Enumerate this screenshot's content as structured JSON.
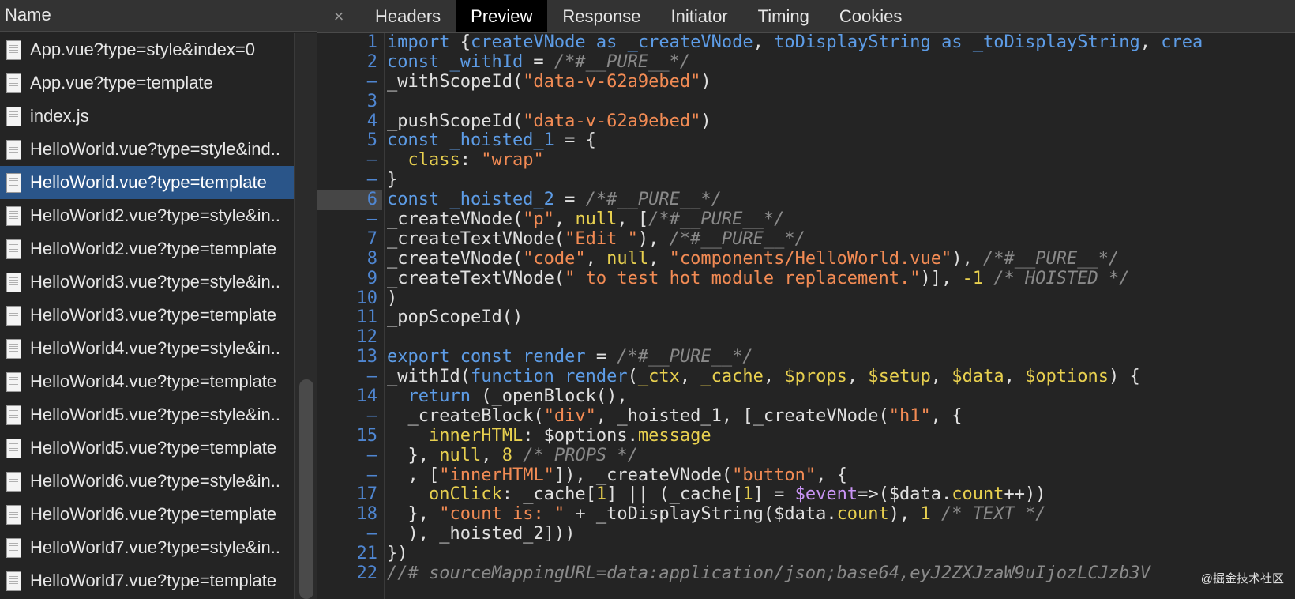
{
  "sidebar": {
    "header": "Name",
    "selected_index": 4,
    "files": [
      "App.vue?type=style&index=0",
      "App.vue?type=template",
      "index.js",
      "HelloWorld.vue?type=style&ind..",
      "HelloWorld.vue?type=template",
      "HelloWorld2.vue?type=style&in..",
      "HelloWorld2.vue?type=template",
      "HelloWorld3.vue?type=style&in..",
      "HelloWorld3.vue?type=template",
      "HelloWorld4.vue?type=style&in..",
      "HelloWorld4.vue?type=template",
      "HelloWorld5.vue?type=style&in..",
      "HelloWorld5.vue?type=template",
      "HelloWorld6.vue?type=style&in..",
      "HelloWorld6.vue?type=template",
      "HelloWorld7.vue?type=style&in..",
      "HelloWorld7.vue?type=template"
    ]
  },
  "tabs": {
    "close_glyph": "×",
    "items": [
      "Headers",
      "Preview",
      "Response",
      "Initiator",
      "Timing",
      "Cookies"
    ],
    "active_index": 1
  },
  "code": {
    "highlight_line_index": 8,
    "lines": [
      {
        "n": "1",
        "t": [
          [
            "kw",
            "import "
          ],
          [
            "",
            "{"
          ],
          [
            "kw",
            "createVNode"
          ],
          [
            "",
            " "
          ],
          [
            "kw",
            "as"
          ],
          [
            "",
            " "
          ],
          [
            "kw",
            "_createVNode"
          ],
          [
            "",
            ", "
          ],
          [
            "kw",
            "toDisplayString"
          ],
          [
            "",
            " "
          ],
          [
            "kw",
            "as"
          ],
          [
            "",
            " "
          ],
          [
            "kw",
            "_toDisplayString"
          ],
          [
            "",
            ", "
          ],
          [
            "kw",
            "crea"
          ]
        ]
      },
      {
        "n": "2",
        "t": [
          [
            "kw",
            "const _withId"
          ],
          [
            "",
            " = "
          ],
          [
            "cm",
            "/*#__PURE__*/"
          ]
        ]
      },
      {
        "n": "–",
        "t": [
          [
            "",
            "_withScopeId("
          ],
          [
            "str",
            "\"data-v-62a9ebed\""
          ],
          [
            "",
            ")"
          ]
        ]
      },
      {
        "n": "3",
        "t": []
      },
      {
        "n": "4",
        "t": [
          [
            "",
            "_pushScopeId("
          ],
          [
            "str",
            "\"data-v-62a9ebed\""
          ],
          [
            "",
            ")"
          ]
        ]
      },
      {
        "n": "5",
        "t": [
          [
            "kw",
            "const _hoisted_1"
          ],
          [
            "",
            " = {"
          ]
        ]
      },
      {
        "n": "–",
        "t": [
          [
            "key",
            "  class"
          ],
          [
            "",
            ": "
          ],
          [
            "str",
            "\"wrap\""
          ]
        ]
      },
      {
        "n": "–",
        "t": [
          [
            "",
            "}"
          ]
        ]
      },
      {
        "n": "6",
        "t": [
          [
            "kw",
            "const _hoisted_2"
          ],
          [
            "",
            " = "
          ],
          [
            "cm",
            "/*#__PURE__*/"
          ]
        ]
      },
      {
        "n": "–",
        "t": [
          [
            "",
            "_createVNode("
          ],
          [
            "str",
            "\"p\""
          ],
          [
            "",
            ", "
          ],
          [
            "key",
            "null"
          ],
          [
            "",
            ", ["
          ],
          [
            "cm",
            "/*#__PURE__*/"
          ]
        ]
      },
      {
        "n": "7",
        "t": [
          [
            "",
            "_createTextVNode("
          ],
          [
            "str",
            "\"Edit \""
          ],
          [
            "",
            "), "
          ],
          [
            "cm",
            "/*#__PURE__*/"
          ]
        ]
      },
      {
        "n": "8",
        "t": [
          [
            "",
            "_createVNode("
          ],
          [
            "str",
            "\"code\""
          ],
          [
            "",
            ", "
          ],
          [
            "key",
            "null"
          ],
          [
            "",
            ", "
          ],
          [
            "str",
            "\"components/HelloWorld.vue\""
          ],
          [
            "",
            "), "
          ],
          [
            "cm",
            "/*#__PURE__*/"
          ]
        ]
      },
      {
        "n": "9",
        "t": [
          [
            "",
            "_createTextVNode("
          ],
          [
            "str",
            "\" to test hot module replacement.\""
          ],
          [
            "",
            ")], "
          ],
          [
            "key",
            "-1"
          ],
          [
            "",
            " "
          ],
          [
            "cm",
            "/* HOISTED */"
          ]
        ]
      },
      {
        "n": "10",
        "t": [
          [
            "",
            ")"
          ]
        ]
      },
      {
        "n": "11",
        "t": [
          [
            "",
            "_popScopeId()"
          ]
        ]
      },
      {
        "n": "12",
        "t": []
      },
      {
        "n": "13",
        "t": [
          [
            "kw",
            "export const render"
          ],
          [
            "",
            " = "
          ],
          [
            "cm",
            "/*#__PURE__*/"
          ]
        ]
      },
      {
        "n": "–",
        "t": [
          [
            "",
            "_withId("
          ],
          [
            "kw",
            "function render"
          ],
          [
            "",
            "("
          ],
          [
            "key",
            "_ctx"
          ],
          [
            "",
            ", "
          ],
          [
            "key",
            "_cache"
          ],
          [
            "",
            ", "
          ],
          [
            "key",
            "$props"
          ],
          [
            "",
            ", "
          ],
          [
            "key",
            "$setup"
          ],
          [
            "",
            ", "
          ],
          [
            "key",
            "$data"
          ],
          [
            "",
            ", "
          ],
          [
            "key",
            "$options"
          ],
          [
            "",
            ") {"
          ]
        ]
      },
      {
        "n": "14",
        "t": [
          [
            "kw",
            "  return"
          ],
          [
            "",
            " (_openBlock(),"
          ]
        ]
      },
      {
        "n": "–",
        "t": [
          [
            "",
            "  _createBlock("
          ],
          [
            "str",
            "\"div\""
          ],
          [
            "",
            ", _hoisted_1, [_createVNode("
          ],
          [
            "str",
            "\"h1\""
          ],
          [
            "",
            ", {"
          ]
        ]
      },
      {
        "n": "15",
        "t": [
          [
            "key",
            "    innerHTML"
          ],
          [
            "",
            ": $options."
          ],
          [
            "key",
            "message"
          ]
        ]
      },
      {
        "n": "–",
        "t": [
          [
            "",
            "  }, "
          ],
          [
            "key",
            "null"
          ],
          [
            "",
            ", "
          ],
          [
            "key",
            "8"
          ],
          [
            "",
            " "
          ],
          [
            "cm",
            "/* PROPS */"
          ]
        ]
      },
      {
        "n": "–",
        "t": [
          [
            "",
            "  , ["
          ],
          [
            "str",
            "\"innerHTML\""
          ],
          [
            "",
            "]), _createVNode("
          ],
          [
            "str",
            "\"button\""
          ],
          [
            "",
            ", {"
          ]
        ]
      },
      {
        "n": "17",
        "t": [
          [
            "key",
            "    onClick"
          ],
          [
            "",
            ": _cache["
          ],
          [
            "key",
            "1"
          ],
          [
            "",
            "] || (_cache["
          ],
          [
            "key",
            "1"
          ],
          [
            "",
            "] = "
          ],
          [
            "var",
            "$event"
          ],
          [
            "",
            "=>($data."
          ],
          [
            "key",
            "count"
          ],
          [
            "",
            "++))"
          ]
        ]
      },
      {
        "n": "18",
        "t": [
          [
            "",
            "  }, "
          ],
          [
            "str",
            "\"count is: \""
          ],
          [
            "",
            " + _toDisplayString($data."
          ],
          [
            "key",
            "count"
          ],
          [
            "",
            "), "
          ],
          [
            "key",
            "1"
          ],
          [
            "",
            " "
          ],
          [
            "cm",
            "/* TEXT */"
          ]
        ]
      },
      {
        "n": "–",
        "t": [
          [
            "",
            "  ), _hoisted_2]))"
          ]
        ]
      },
      {
        "n": "21",
        "t": [
          [
            "",
            "})"
          ]
        ]
      },
      {
        "n": "22",
        "t": [
          [
            "cm",
            "//# sourceMappingURL=data:application/json;base64,eyJ2ZXJzaW9uIjozLCJzb3V"
          ]
        ]
      }
    ]
  },
  "watermark": "@掘金技术社区"
}
